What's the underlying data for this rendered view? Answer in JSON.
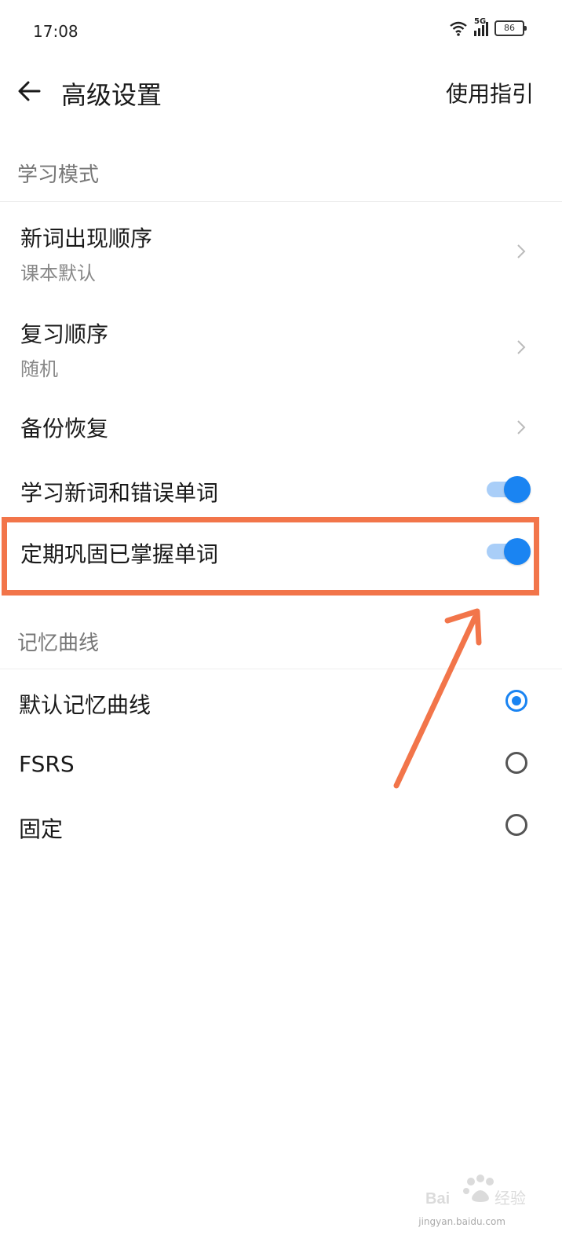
{
  "status_bar": {
    "time": "17:08",
    "network": "5G",
    "battery": "86"
  },
  "header": {
    "title": "高级设置",
    "guide": "使用指引"
  },
  "study_mode": {
    "section_title": "学习模式",
    "new_word_order": {
      "title": "新词出现顺序",
      "value": "课本默认"
    },
    "review_order": {
      "title": "复习顺序",
      "value": "随机"
    },
    "backup": {
      "title": "备份恢复"
    },
    "learn_new_and_wrong": {
      "title": "学习新词和错误单词",
      "on": true
    },
    "consolidate": {
      "title": "定期巩固已掌握单词",
      "on": true
    }
  },
  "memory_curve": {
    "section_title": "记忆曲线",
    "options": [
      {
        "label": "默认记忆曲线",
        "selected": true
      },
      {
        "label": "FSRS",
        "selected": false
      },
      {
        "label": "固定",
        "selected": false
      }
    ]
  },
  "colors": {
    "accent": "#1a84f2",
    "annotation": "#f2754a"
  },
  "watermark": {
    "logo_text": "Baidu经验",
    "url_text": "jingyan.baidu.com"
  }
}
